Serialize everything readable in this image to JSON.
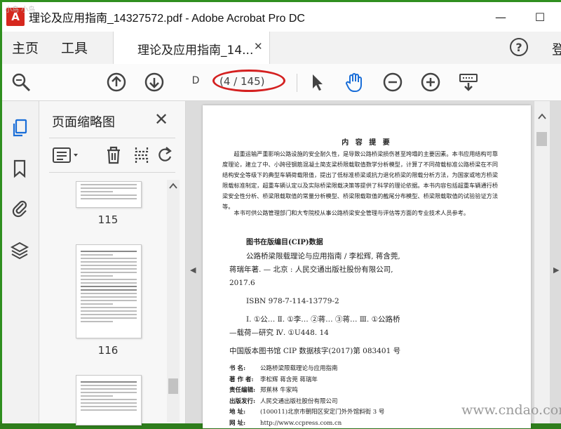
{
  "window": {
    "title": "理论及应用指南_14327572.pdf - Adobe Acrobat Pro DC",
    "app_icon_label": "A",
    "minimize_label": "—",
    "maximize_label": "☐",
    "accent_color": "#2f8f1f"
  },
  "menubar": {
    "home": "主页",
    "tools": "工具",
    "doc_tab_label": "理论及应用指南_14...",
    "tab_close": "✕",
    "help": "?",
    "signin_partial": "登"
  },
  "toolbar": {
    "page_input_value": "D",
    "page_count": "(4 / 145)",
    "icons": [
      "search-zoom-icon",
      "page-up-icon",
      "page-down-icon",
      "select-arrow-icon",
      "hand-tool-icon",
      "zoom-out-icon",
      "zoom-in-icon",
      "keyboard-icon"
    ]
  },
  "thumbnails_panel": {
    "title": "页面缩略图",
    "close": "✕",
    "pages": [
      {
        "label": "115"
      },
      {
        "label": "116"
      }
    ]
  },
  "document": {
    "summary_title": "内 容 提 要",
    "summary_body": "超重运输严重影响公路设施的安全耐久性，是导致公路桥梁损伤甚至垮塌的主要因素。本书应用结构可靠度理论，建立了中、小跨径钢筋混凝土简支梁桥限载取值数学分析模型，计算了不同荷载标准公路桥梁在不同结构安全等级下的典型车辆荷载限值，提出了低标准桥梁或抗力退化桥梁的限载分析方法，为国家或地方桥梁限载标准制定，超重车辆认定以及实际桥梁限载决策等提供了科学的理论依据。本书内容包括超重车辆通行桥梁安全性分析、桥梁限载取值的常量分析模型、桥梁限载取值的截尾分布模型、桥梁限载取值的试验验证方法等。",
    "summary_audience": "本书可供公路管理部门和大专院校从事公路桥梁安全管理与评估等方面的专业技术人员参考。",
    "cip_title": "图书在版编目(CIP)数据",
    "cip_lines": [
      "公路桥梁限载理论与应用指南 / 李松辉, 蒋含莞,",
      "蒋瑞年著. — 北京 : 人民交通出版社股份有限公司,",
      "2017.6",
      "ISBN  978-7-114-13779-2",
      "Ⅰ. ①公…   Ⅱ. ①李…  ②蒋…  ③蒋…   Ⅲ. ①公路桥",
      "—载荷—研究   Ⅳ. ①U448. 14",
      "中国版本图书馆 CIP 数据核字(2017)第 083401 号"
    ],
    "info": [
      {
        "k": "书      名:",
        "v": "公路桥梁限载理论与应用指南"
      },
      {
        "k": "著 作 者:",
        "v": "李松辉    蒋含莞    蒋瑞年"
      },
      {
        "k": "责任编辑:",
        "v": "郑蕉林    牛家鸣"
      },
      {
        "k": "出版发行:",
        "v": "人民交通出版社股份有限公司"
      },
      {
        "k": "地      址:",
        "v": "(100011)北京市朝阳区安定门外外馆斜街 3 号"
      },
      {
        "k": "网      址:",
        "v": "http://www.ccpress.com.cn"
      }
    ]
  },
  "watermark": "www.cndao.com",
  "corner_watermark": "小鸟 小鸟"
}
